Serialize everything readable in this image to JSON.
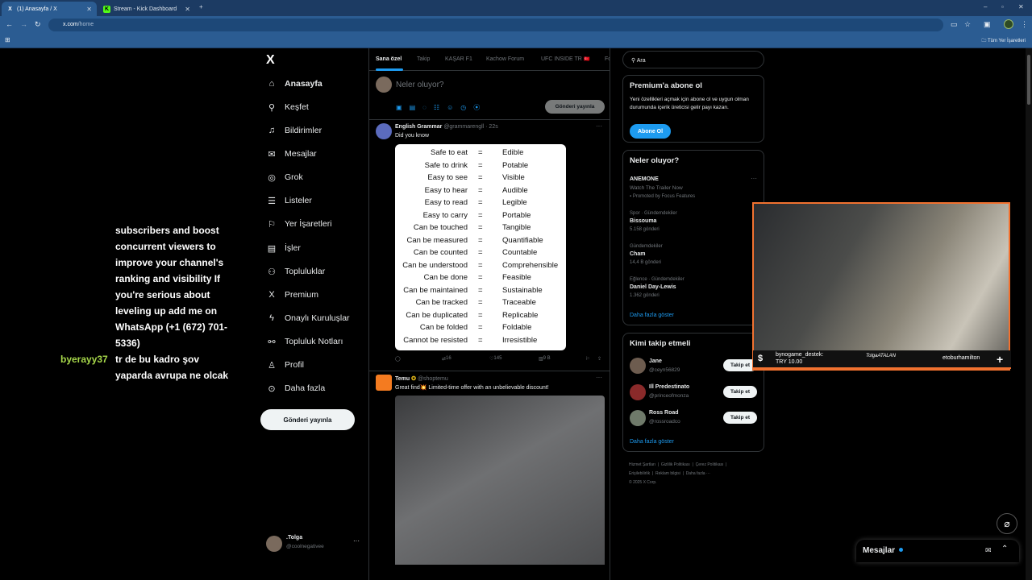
{
  "browser": {
    "tabs": [
      {
        "label": "(1) Anasayfa / X",
        "icon": "x-logo-icon"
      },
      {
        "label": "Stream - Kick Dashboard",
        "icon": "kick-logo-icon"
      }
    ],
    "url_host": "x.com",
    "url_path": "/home",
    "bookmarks_label": "Tüm Yer İşaretleri"
  },
  "left_nav": {
    "logo": "X",
    "items": [
      {
        "label": "Anasayfa",
        "icon": "home-icon"
      },
      {
        "label": "Keşfet",
        "icon": "search-icon"
      },
      {
        "label": "Bildirimler",
        "icon": "bell-icon"
      },
      {
        "label": "Mesajlar",
        "icon": "mail-icon"
      },
      {
        "label": "Grok",
        "icon": "grok-icon"
      },
      {
        "label": "Listeler",
        "icon": "list-icon"
      },
      {
        "label": "Yer İşaretleri",
        "icon": "bookmark-icon"
      },
      {
        "label": "İşler",
        "icon": "briefcase-icon"
      },
      {
        "label": "Topluluklar",
        "icon": "people-icon"
      },
      {
        "label": "Premium",
        "icon": "x-premium-icon"
      },
      {
        "label": "Onaylı Kuruluşlar",
        "icon": "lightning-icon"
      },
      {
        "label": "Topluluk Notları",
        "icon": "notes-icon"
      },
      {
        "label": "Profil",
        "icon": "person-icon"
      },
      {
        "label": "Daha fazla",
        "icon": "more-circle-icon"
      }
    ],
    "post_button": "Gönderi yayınla",
    "profile": {
      "name": ".Tolga",
      "handle": "@coolnegativee"
    }
  },
  "feed": {
    "tabs": [
      "Sana özel",
      "Takip",
      "KAŞAR F1",
      "Kachow Forum",
      "UFC INSIDE TR",
      "Fo"
    ],
    "compose_placeholder": "Neler oluyor?",
    "compose_button": "Gönderi yayınla",
    "tweet1": {
      "name": "English Grammar",
      "handle": "@grammarengll · 22s",
      "text": "Did you know",
      "rows": [
        [
          "Safe to eat",
          "=",
          "Edible"
        ],
        [
          "Safe to drink",
          "=",
          "Potable"
        ],
        [
          "Easy to see",
          "=",
          "Visible"
        ],
        [
          "Easy to hear",
          "=",
          "Audible"
        ],
        [
          "Easy to read",
          "=",
          "Legible"
        ],
        [
          "Easy to carry",
          "=",
          "Portable"
        ],
        [
          "Can be touched",
          "=",
          "Tangible"
        ],
        [
          "Can be measured",
          "=",
          "Quantifiable"
        ],
        [
          "Can be counted",
          "=",
          "Countable"
        ],
        [
          "Can be understood",
          "=",
          "Comprehensible"
        ],
        [
          "Can be done",
          "=",
          "Feasible"
        ],
        [
          "Can be maintained",
          "=",
          "Sustainable"
        ],
        [
          "Can be tracked",
          "=",
          "Traceable"
        ],
        [
          "Can be duplicated",
          "=",
          "Replicable"
        ],
        [
          "Can be folded",
          "=",
          "Foldable"
        ],
        [
          "Cannot be resisted",
          "=",
          "Irresistible"
        ]
      ],
      "retweets": "16",
      "likes": "145",
      "views": "9 B"
    },
    "tweet2": {
      "name": "Temu",
      "handle": "@shoptemu",
      "text": "Great find💥 Limited-time offer with an unbelievable discount!"
    }
  },
  "right": {
    "search_placeholder": "Ara",
    "premium": {
      "title": "Premium'a abone ol",
      "text": "Yeni özellikleri açmak için abone ol ve uygun olman durumunda içerik üreticisi gelir payı kazan.",
      "button": "Abone Ol"
    },
    "trends": {
      "title": "Neler oluyor?",
      "items": [
        {
          "meta": "",
          "name": "ANEMONE",
          "sub": "Watch The Trailer Now",
          "extra": "Promoted by Focus Features"
        },
        {
          "meta": "Spor · Gündemdekiler",
          "name": "Bissouma",
          "sub": "5.158 gönderi",
          "extra": ""
        },
        {
          "meta": "Gündemdekiler",
          "name": "Cham",
          "sub": "14,4 B gönderi",
          "extra": ""
        },
        {
          "meta": "Eğlence · Gündemdekiler",
          "name": "Daniel Day-Lewis",
          "sub": "1.362 gönderi",
          "extra": ""
        }
      ],
      "more": "Daha fazla göster"
    },
    "who_to_follow": {
      "title": "Kimi takip etmeli",
      "users": [
        {
          "name": "Jane",
          "handle": "@ceyn56829"
        },
        {
          "name": "Ill Predestinato",
          "handle": "@princeofmonza"
        },
        {
          "name": "Ross Road",
          "handle": "@rossroadco"
        }
      ],
      "follow_label": "Takip et",
      "more": "Daha fazla göster"
    },
    "footer": [
      "Hizmet Şartları",
      "Gizlilik Politikası",
      "Çerez Politikası",
      "Erişilebilirlik",
      "Reklam bilgisi",
      "Daha fazla ···",
      "© 2025 X Corp."
    ]
  },
  "stream_overlay": {
    "chat": [
      {
        "user": "",
        "text": "subscribers and boost concurrent viewers to improve your channel's ranking and visibility If you're serious about leveling up add me on WhatsApp (+1 (672) 701-5336)"
      },
      {
        "user": "byerayy37",
        "text": "tr de bu kadro şov yaparda avrupa ne olcak"
      }
    ],
    "alert": {
      "user": "bynogame_destek:",
      "amount": "TRY 10.00",
      "signature": "TolgaATALAN",
      "right_user": "etoburhamilton"
    }
  },
  "messages_drawer": {
    "title": "Mesajlar"
  },
  "colors": {
    "accent": "#1d9bf0",
    "chrome": "#2b5c92",
    "stream_border": "#f27230",
    "chat_user": "#a7d84a"
  }
}
